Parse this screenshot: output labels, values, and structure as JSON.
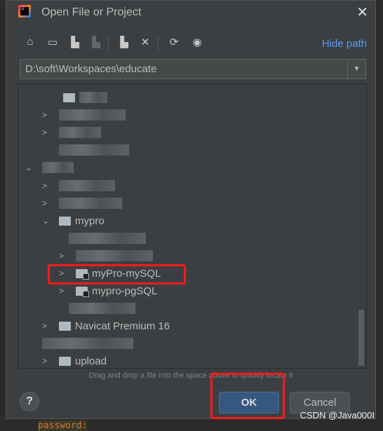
{
  "title": "Open File or Project",
  "toolbar": {
    "icons": [
      "home-icon",
      "desktop-icon",
      "project-folder-icon",
      "module-folder-icon",
      "new-folder-icon",
      "delete-icon",
      "refresh-icon",
      "show-hidden-icon"
    ],
    "hide_path": "Hide path"
  },
  "path": "D:\\soft\\Workspaces\\educate",
  "tree": {
    "mypro": "mypro",
    "mypro_mysql": "myPro-mySQL",
    "mypro_pgsql": "mypro-pgSQL",
    "navicat": "Navicat Premium 16",
    "upload": "upload"
  },
  "hint": "Drag and drop a file into the space above to quickly locate it",
  "buttons": {
    "help": "?",
    "ok": "OK",
    "cancel": "Cancel"
  },
  "watermark": "CSDN @Java000I",
  "background_code": "password:",
  "colors": {
    "accent": "#589df6",
    "ok": "#365880",
    "highlight": "#ff1a1a"
  }
}
